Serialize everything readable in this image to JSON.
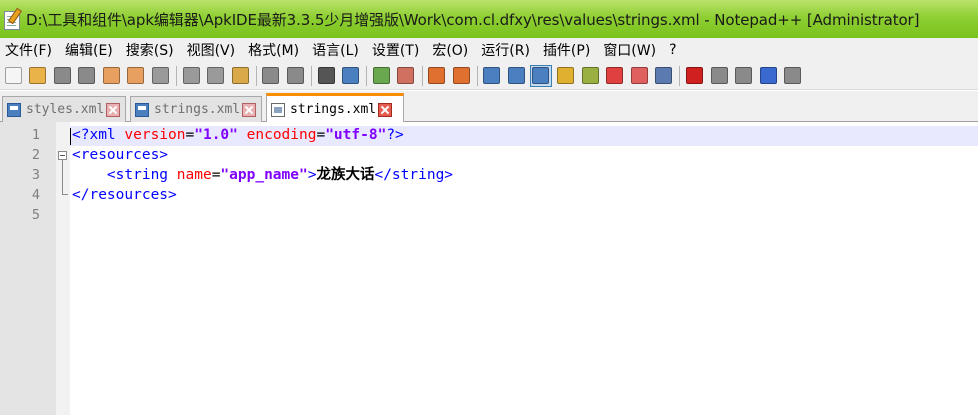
{
  "window": {
    "title": "D:\\工具和组件\\apk编辑器\\ApkIDE最新3.3.5少月增强版\\Work\\com.cl.dfxy\\res\\values\\strings.xml - Notepad++ [Administrator]"
  },
  "menu": [
    "文件(F)",
    "编辑(E)",
    "搜索(S)",
    "视图(V)",
    "格式(M)",
    "语言(L)",
    "设置(T)",
    "宏(O)",
    "运行(R)",
    "插件(P)",
    "窗口(W)",
    "?"
  ],
  "toolbar": [
    {
      "icon": "new-file-icon",
      "color": "#f5f5f5"
    },
    {
      "icon": "open-file-icon",
      "color": "#e9b34a"
    },
    {
      "icon": "save-icon",
      "color": "#8a8a8a"
    },
    {
      "icon": "save-all-icon",
      "color": "#8a8a8a"
    },
    {
      "icon": "close-icon",
      "color": "#e8a060"
    },
    {
      "icon": "close-all-icon",
      "color": "#e8a060"
    },
    {
      "icon": "print-icon",
      "color": "#9a9a9a"
    },
    {
      "sep": true
    },
    {
      "icon": "cut-icon",
      "color": "#9a9a9a"
    },
    {
      "icon": "copy-icon",
      "color": "#9a9a9a"
    },
    {
      "icon": "paste-icon",
      "color": "#d9a94a"
    },
    {
      "sep": true
    },
    {
      "icon": "undo-icon",
      "color": "#8a8a8a"
    },
    {
      "icon": "redo-icon",
      "color": "#8a8a8a"
    },
    {
      "sep": true
    },
    {
      "icon": "find-icon",
      "color": "#555555"
    },
    {
      "icon": "replace-icon",
      "color": "#4a7fc0"
    },
    {
      "sep": true
    },
    {
      "icon": "zoom-in-icon",
      "color": "#6aa84f"
    },
    {
      "icon": "zoom-out-icon",
      "color": "#d07060"
    },
    {
      "sep": true
    },
    {
      "icon": "sync-vertical-icon",
      "color": "#e07030"
    },
    {
      "icon": "sync-horizontal-icon",
      "color": "#e07030"
    },
    {
      "sep": true
    },
    {
      "icon": "word-wrap-icon",
      "color": "#4a7fc0"
    },
    {
      "icon": "show-all-characters-icon",
      "color": "#4a7fc0"
    },
    {
      "icon": "indent-guide-icon",
      "color": "#4a7fc0",
      "active": true
    },
    {
      "icon": "language-icon",
      "color": "#e0b030"
    },
    {
      "icon": "document-map-icon",
      "color": "#9ab040"
    },
    {
      "icon": "function-list-icon",
      "color": "#e04040"
    },
    {
      "icon": "folder-as-workspace-icon",
      "color": "#e06060"
    },
    {
      "icon": "monitoring-icon",
      "color": "#5a7ab0"
    },
    {
      "sep": true
    },
    {
      "icon": "record-macro-icon",
      "color": "#d02020"
    },
    {
      "icon": "stop-recording-icon",
      "color": "#8a8a8a"
    },
    {
      "icon": "playback-icon",
      "color": "#8a8a8a"
    },
    {
      "icon": "run-macro-multiple-icon",
      "color": "#3a6ad0"
    },
    {
      "icon": "save-macro-icon",
      "color": "#8a8a8a"
    }
  ],
  "tabs": [
    {
      "label": "styles.xml",
      "active": false
    },
    {
      "label": "strings.xml",
      "active": false
    },
    {
      "label": "strings.xml",
      "active": true
    }
  ],
  "editor": {
    "line_numbers": [
      "1",
      "2",
      "3",
      "4",
      "5"
    ],
    "lines": [
      {
        "parts": [
          {
            "t": "<?xml ",
            "c": "tag"
          },
          {
            "t": "version",
            "c": "attr"
          },
          {
            "t": "=",
            "c": "q"
          },
          {
            "t": "\"1.0\"",
            "c": "str"
          },
          {
            "t": " ",
            "c": "q"
          },
          {
            "t": "encoding",
            "c": "attr"
          },
          {
            "t": "=",
            "c": "q"
          },
          {
            "t": "\"utf-8\"",
            "c": "str"
          },
          {
            "t": "?>",
            "c": "tag"
          }
        ]
      },
      {
        "parts": [
          {
            "t": "<resources>",
            "c": "tag"
          }
        ]
      },
      {
        "parts": [
          {
            "t": "    ",
            "c": "q"
          },
          {
            "t": "<string ",
            "c": "tag"
          },
          {
            "t": "name",
            "c": "attr"
          },
          {
            "t": "=",
            "c": "q"
          },
          {
            "t": "\"app_name\"",
            "c": "str"
          },
          {
            "t": ">",
            "c": "tag"
          },
          {
            "t": "龙族大话",
            "c": "text"
          },
          {
            "t": "</string>",
            "c": "tag"
          }
        ]
      },
      {
        "parts": [
          {
            "t": "</resources>",
            "c": "tag"
          }
        ]
      },
      {
        "parts": []
      }
    ]
  }
}
